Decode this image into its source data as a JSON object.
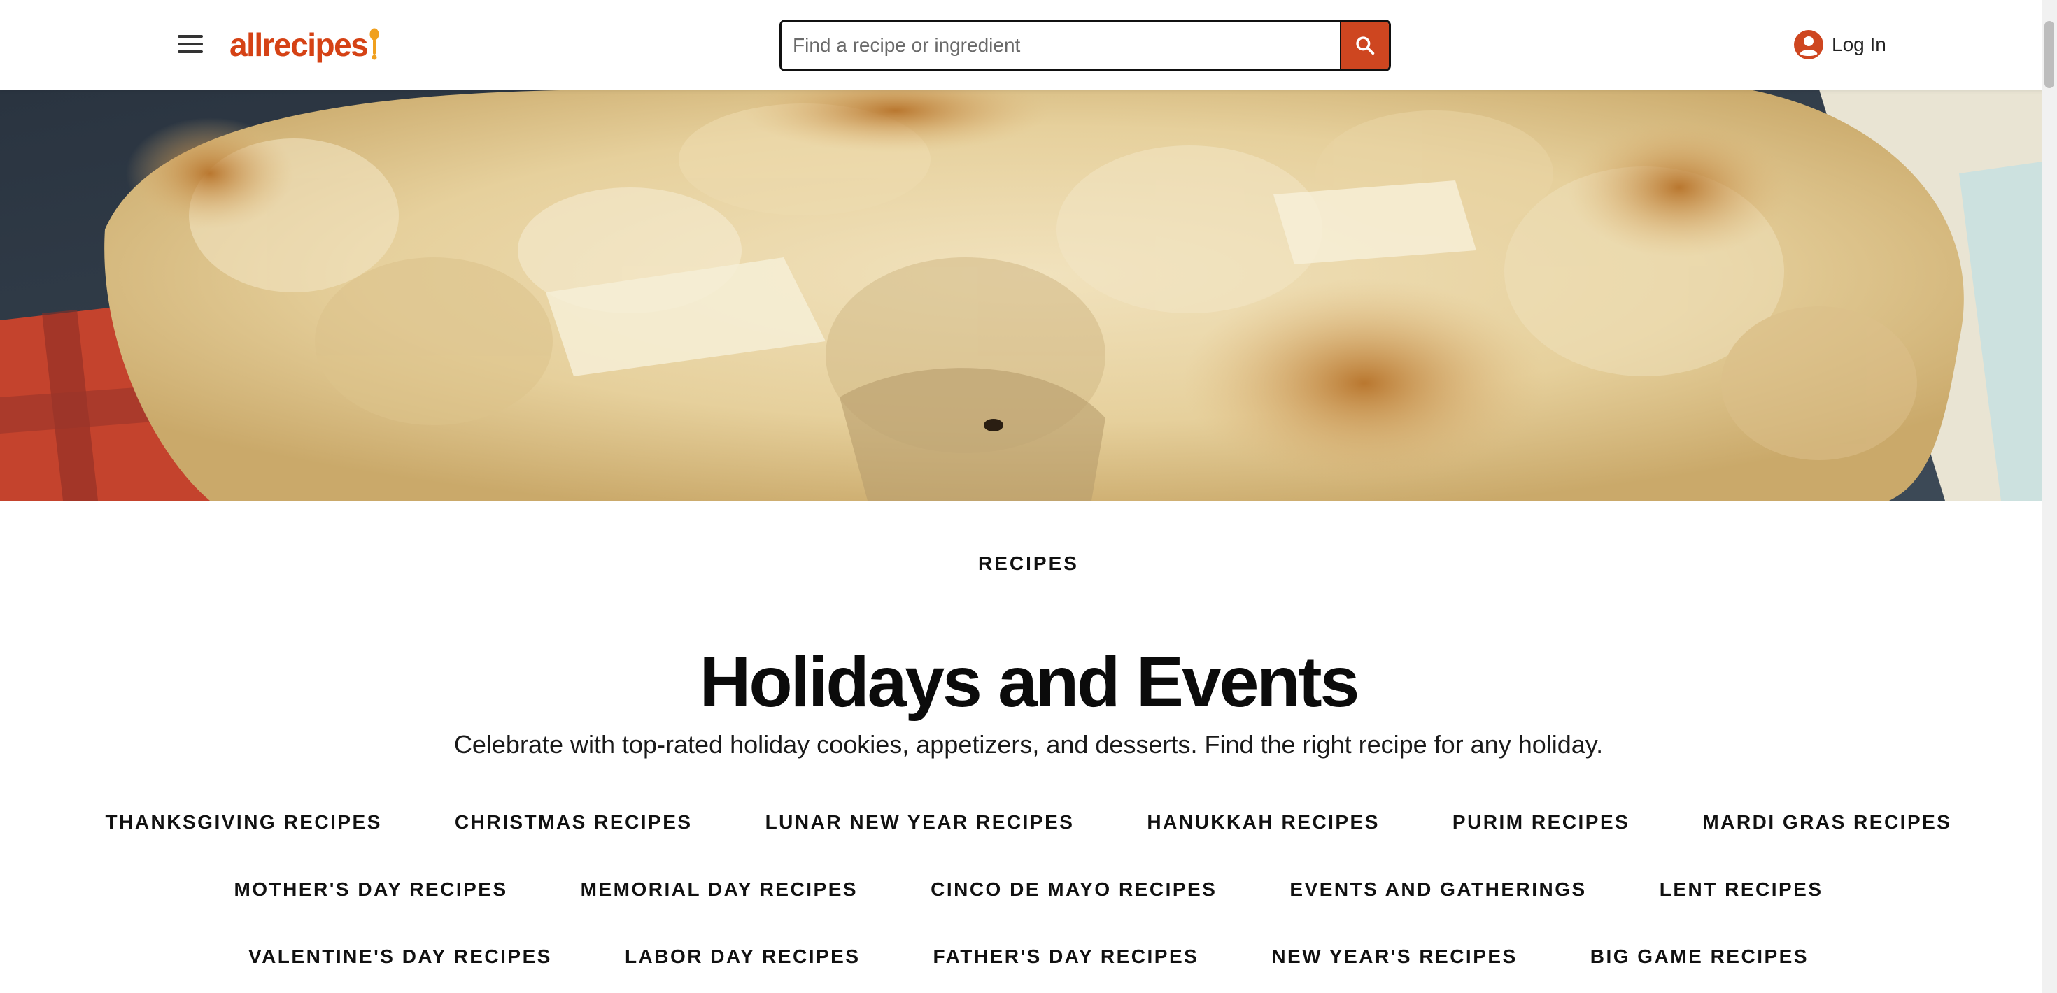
{
  "header": {
    "menu_icon": "hamburger-menu-icon",
    "logo_text": "allrecipes",
    "search": {
      "placeholder": "Find a recipe or ingredient",
      "icon": "search-icon"
    },
    "login": {
      "label": "Log In",
      "icon": "user-account-icon"
    }
  },
  "colors": {
    "brand": "#ce4620",
    "text": "#111111"
  },
  "hero": {
    "image": "apple-pie-crust-closeup"
  },
  "page": {
    "eyebrow": "RECIPES",
    "title": "Holidays and Events",
    "subtitle": "Celebrate with top-rated holiday cookies, appetizers, and desserts. Find the right recipe for any holiday."
  },
  "links": [
    [
      "THANKSGIVING RECIPES",
      "CHRISTMAS RECIPES",
      "LUNAR NEW YEAR RECIPES",
      "HANUKKAH RECIPES",
      "PURIM RECIPES",
      "MARDI GRAS RECIPES"
    ],
    [
      "MOTHER'S DAY RECIPES",
      "MEMORIAL DAY RECIPES",
      "CINCO DE MAYO RECIPES",
      "EVENTS AND GATHERINGS",
      "LENT RECIPES"
    ],
    [
      "VALENTINE'S DAY RECIPES",
      "LABOR DAY RECIPES",
      "FATHER'S DAY RECIPES",
      "NEW YEAR'S RECIPES",
      "BIG GAME RECIPES"
    ]
  ]
}
